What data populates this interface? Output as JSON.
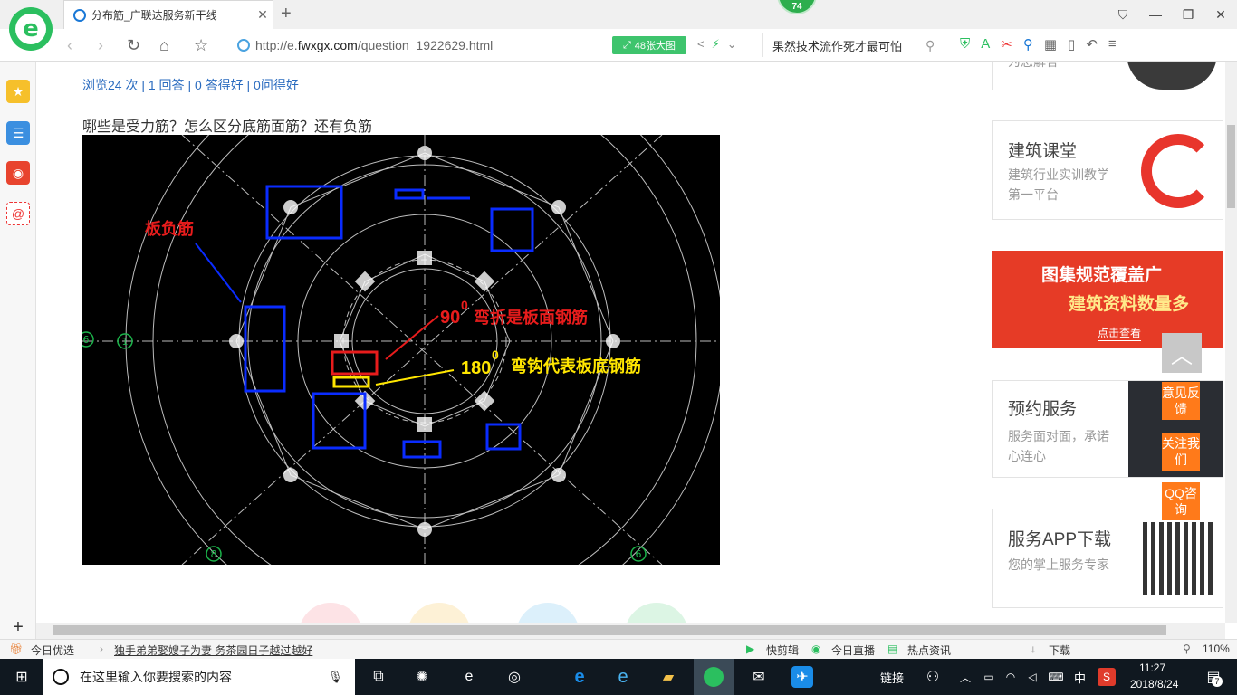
{
  "browser": {
    "tab_title": "分布筋_广联达服务新干线",
    "tab_close": "✕",
    "new_tab": "+",
    "badge_count": "74",
    "url_prefix": "http://e.",
    "url_domain": "fwxgx.com",
    "url_path": "/question_1922629.html",
    "image_button": "48张大图",
    "search_text": "果然技术流作死才最可怕",
    "window_controls": [
      "⛉",
      "—",
      "❐",
      "✕"
    ]
  },
  "page": {
    "stats": "浏览24 次 | 1 回答 | 0 答得好 | 0问得好",
    "question": "哪些是受力筋？怎么区分底筋面筋？还有负筋",
    "image": {
      "label_board_negative": "板负筋",
      "label_90": "90",
      "label_90_sup": "0",
      "label_90_text": "弯折是板面钢筋",
      "label_180": "180",
      "label_180_sup": "0",
      "label_180_text": "弯钩代表板底钢筋",
      "axis_labels": [
        "1",
        "8",
        "6",
        "6"
      ]
    }
  },
  "sidebar_cards": [
    {
      "title": "",
      "desc": "为您解答"
    },
    {
      "title": "建筑课堂",
      "desc": "建筑行业实训教学第一平台"
    },
    {
      "title": "图集规范覆盖广",
      "desc": "建筑资料数量多",
      "cta": "点击查看"
    },
    {
      "title": "预约服务",
      "desc": "服务面对面，承诺心连心"
    },
    {
      "title": "服务APP下载",
      "desc": "您的掌上服务专家"
    }
  ],
  "float_buttons": {
    "feedback": "意见反馈",
    "follow": "关注我们",
    "qq": "QQ咨询",
    "to_top": "︿"
  },
  "statusbar": {
    "today": "今日优选",
    "news": "独手弟弟娶嫂子为妻 务茶园日子越过越好",
    "kuaijian": "快剪辑",
    "live": "今日直播",
    "hot": "热点资讯",
    "download": "下载",
    "zoom": "110%"
  },
  "taskbar": {
    "search_placeholder": "在这里输入你要搜索的内容",
    "links": "链接",
    "ime": "中",
    "time": "11:27",
    "date": "2018/8/24",
    "notif": "7"
  },
  "colors": {
    "brand_green": "#2bbf5f",
    "link_blue": "#2a6bbf",
    "orange": "#ff7a1a",
    "cad_red": "#e81c1c",
    "cad_yellow": "#ffe600"
  }
}
